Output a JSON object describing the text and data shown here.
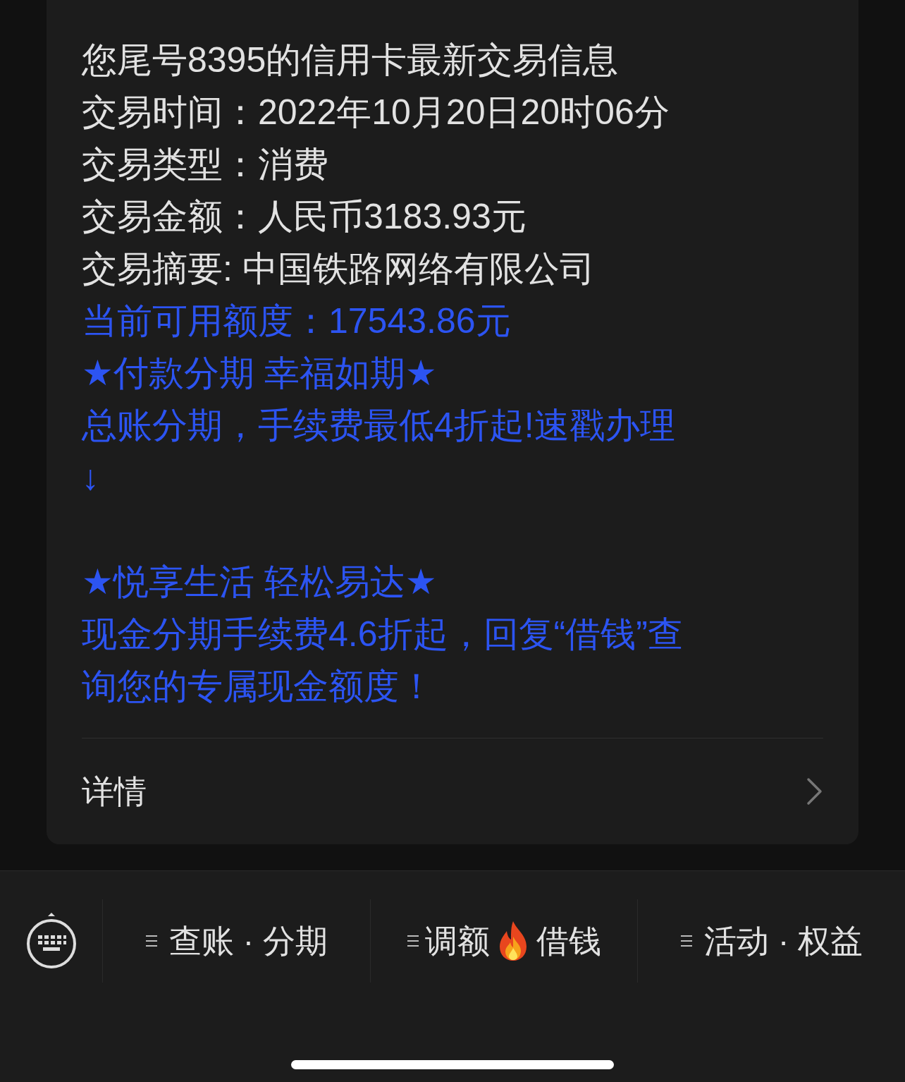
{
  "message": {
    "lines": [
      {
        "text": "您尾号8395的信用卡最新交易信息",
        "kind": "plain",
        "section_break": false
      },
      {
        "text": "交易时间：2022年10月20日20时06分",
        "kind": "plain",
        "section_break": false
      },
      {
        "text": "交易类型：消费",
        "kind": "plain",
        "section_break": false
      },
      {
        "text": "交易金额：人民币3183.93元",
        "kind": "plain",
        "section_break": false
      },
      {
        "text": "交易摘要: 中国铁路网络有限公司",
        "kind": "plain",
        "section_break": false
      },
      {
        "text": "当前可用额度：17543.86元",
        "kind": "highlight",
        "section_break": false
      },
      {
        "text": "★付款分期 幸福如期★",
        "kind": "highlight",
        "section_break": false
      },
      {
        "text": "总账分期，手续费最低4折起!速戳办理",
        "kind": "highlight",
        "section_break": false
      },
      {
        "text": "↓",
        "kind": "highlight",
        "section_break": false
      },
      {
        "text": "★悦享生活 轻松易达★",
        "kind": "highlight",
        "section_break": true
      },
      {
        "text": "现金分期手续费4.6折起，回复“借钱”查",
        "kind": "highlight",
        "section_break": false
      },
      {
        "text": "询您的专属现金额度！",
        "kind": "highlight",
        "section_break": false
      }
    ],
    "details": "详情"
  },
  "menu": [
    {
      "parts": [
        "查账 · 分期"
      ],
      "kind": "plain"
    },
    {
      "parts": [
        "调额",
        "借钱"
      ],
      "kind": "fire"
    },
    {
      "parts": [
        "活动 · 权益"
      ],
      "kind": "plain"
    }
  ]
}
